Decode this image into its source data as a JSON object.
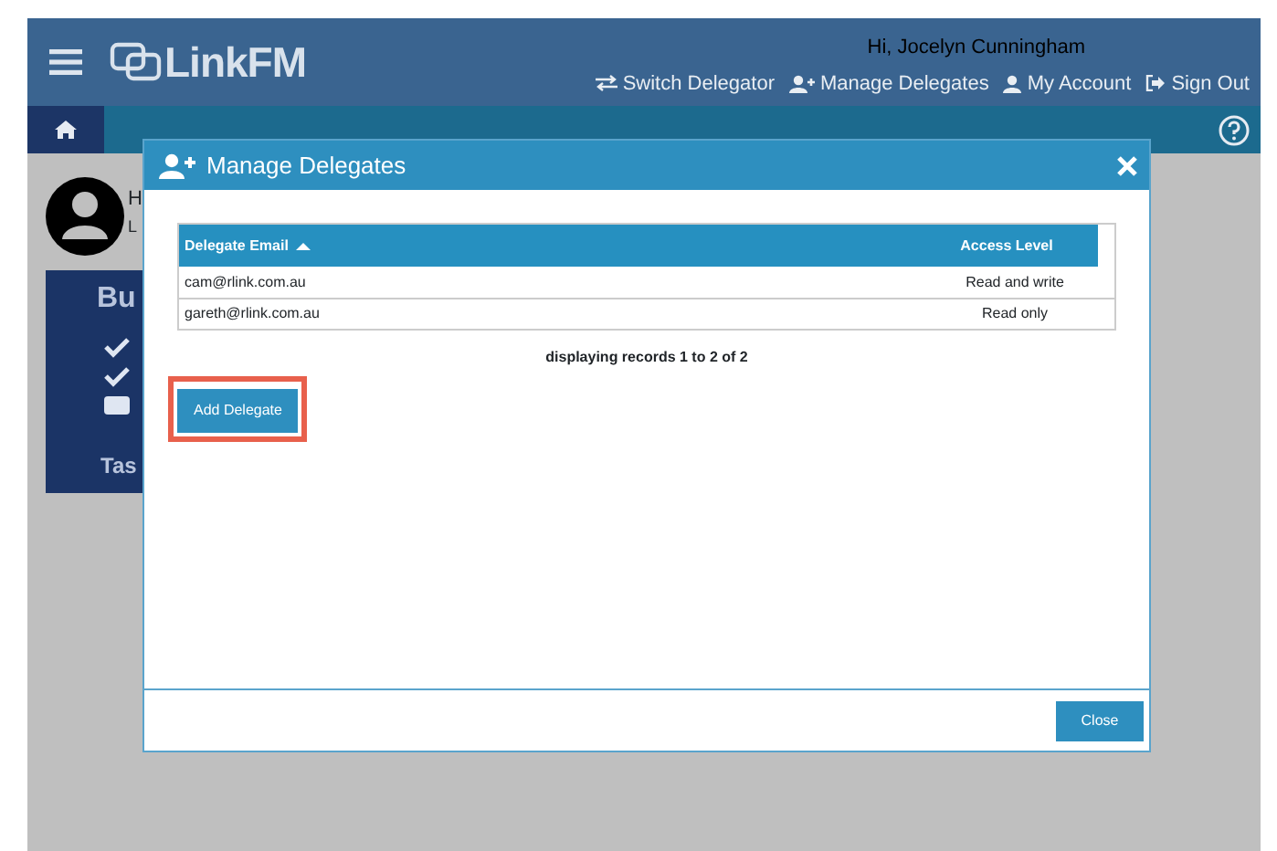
{
  "header": {
    "logo": "LinkFM",
    "greeting": "Hi, Jocelyn Cunningham",
    "links": [
      {
        "label": "Switch Delegator"
      },
      {
        "label": "Manage Delegates"
      },
      {
        "label": "My Account"
      },
      {
        "label": "Sign Out"
      }
    ]
  },
  "profile": {
    "name": "H",
    "subtitle": "L"
  },
  "card": {
    "title": "Bu",
    "items": [
      {
        "checked": true
      },
      {
        "checked": true
      },
      {
        "checked": false
      }
    ],
    "footer": "Tas"
  },
  "modal": {
    "title": "Manage Delegates",
    "columns": [
      {
        "label": "Delegate Email",
        "sorted": true
      },
      {
        "label": "Access Level",
        "sorted": false
      }
    ],
    "rows": [
      [
        "cam@rlink.com.au",
        "Read and write"
      ],
      [
        "gareth@rlink.com.au",
        "Read only"
      ]
    ],
    "records": "displaying records 1 to 2 of 2",
    "add_button": {
      "label": "Add Delegate",
      "highlighted": true
    },
    "close_button": "Close"
  }
}
